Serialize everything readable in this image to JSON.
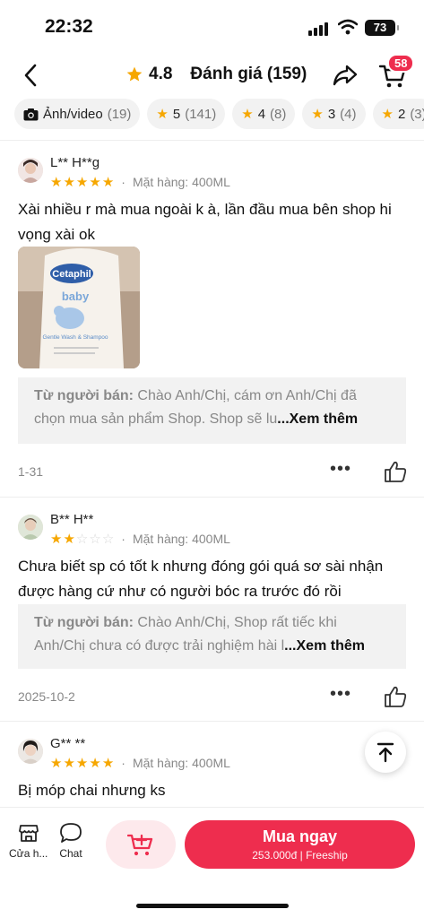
{
  "status": {
    "time": "22:32",
    "battery": "73"
  },
  "header": {
    "rating": "4.8",
    "title": "Đánh giá (159)",
    "cart_count": "58"
  },
  "filters": [
    {
      "label": "Ảnh/video",
      "count": "(19)"
    },
    {
      "label": "5",
      "count": "(141)"
    },
    {
      "label": "4",
      "count": "(8)"
    },
    {
      "label": "3",
      "count": "(4)"
    },
    {
      "label": "2",
      "count": "(3)"
    }
  ],
  "reviews": [
    {
      "user": "L** H**g",
      "stars": 5,
      "variant": "Mặt hàng: 400ML",
      "text": "Xài nhiều r mà mua ngoài k à, lần đầu mua bên shop hi vọng xài ok",
      "photo_brand": "Cetaphil",
      "photo_sub": "baby",
      "photo_text": "Gentle Wash & Shampoo",
      "seller_label": "Từ người bán:",
      "seller_text": " Chào Anh/Chị, cám ơn Anh/Chị đã chọn mua sản phẩm Shop. Shop sẽ lu",
      "more": "...Xem thêm",
      "date": "1-31"
    },
    {
      "user": "B** H**",
      "stars": 2,
      "variant": "Mặt hàng: 400ML",
      "text": "Chưa biết sp có tốt k nhưng đóng gói quá sơ sài nhận được hàng cứ như có người bóc ra trước đó rồi",
      "seller_label": "Từ người bán:",
      "seller_text": " Chào Anh/Chị, Shop rất tiếc khi Anh/Chị chưa có được trải nghiệm hài l",
      "more": "...Xem thêm",
      "date": "2025-10-2"
    },
    {
      "user": "G** **",
      "stars": 5,
      "variant": "Mặt hàng: 400ML",
      "text": "Bị móp chai nhưng ks"
    }
  ],
  "bottom": {
    "shop_label": "Cửa h...",
    "chat_label": "Chat",
    "buy_label": "Mua ngay",
    "price": "253.000đ",
    "shipping": "Freeship"
  },
  "colors": {
    "accent": "#ee2d4e",
    "star": "#f6a700"
  }
}
